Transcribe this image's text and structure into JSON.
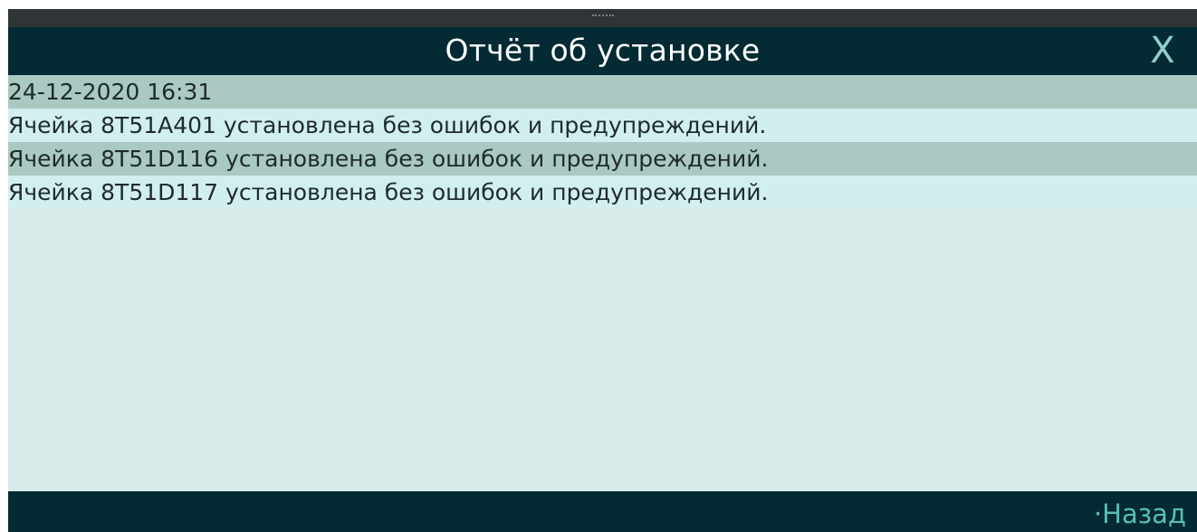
{
  "window": {
    "title": "Отчёт об установке",
    "close_label": "X"
  },
  "report": {
    "rows": [
      "24-12-2020 16:31",
      "Ячейка 8T51A401 установлена без ошибок и предупреждений.",
      "Ячейка 8T51D116 установлена без ошибок и предупреждений.",
      "Ячейка 8T51D117 установлена без ошибок и предупреждений."
    ]
  },
  "footer": {
    "back_label": "·Назад"
  },
  "colors": {
    "header_background": "#042a33",
    "content_background": "#d7ecea",
    "row_dark": "#a9c9c2",
    "row_light": "#d1efee",
    "accent": "#54c1b5"
  },
  "icons": {
    "close": "close-icon"
  }
}
